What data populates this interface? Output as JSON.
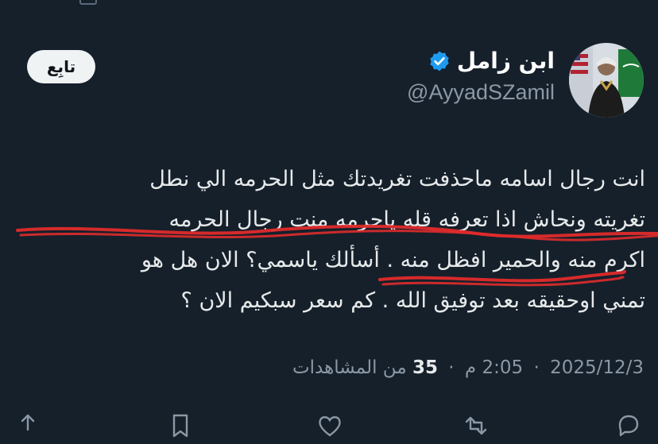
{
  "author": {
    "display_name": "ابن زامل",
    "handle": "@AyyadSZamil",
    "verified": true,
    "avatar_icon": "profile-photo-with-flags"
  },
  "follow_button": {
    "label": "تابِع"
  },
  "tweet": {
    "lines": [
      "انت رجال اسامه ماحذفت تغريدتك مثل الحرمه الي نطل",
      "تغريته ونحاش اذا تعرفه قله ياحرمه منت رجال الحرمه",
      "اكرم منه والحمير افظل منه . أسألك ياسمي؟ الان هل هو",
      "تمني اوحقيقه بعد توفيق الله . كم سعر سبكيم الان ؟"
    ]
  },
  "meta": {
    "date": "2025/12/3",
    "time": "2:05 م",
    "views_count": "35",
    "views_label": "من المشاهدات",
    "separator": "·"
  },
  "colors": {
    "background": "#15202b",
    "text": "#e7e9ea",
    "muted": "#8b98a5",
    "verified_blue": "#1d9bf0",
    "scribble_red": "#e02b2b"
  },
  "actions": {
    "icons": [
      "share-icon",
      "bookmark-icon",
      "like-icon",
      "retweet-icon",
      "reply-icon"
    ]
  }
}
